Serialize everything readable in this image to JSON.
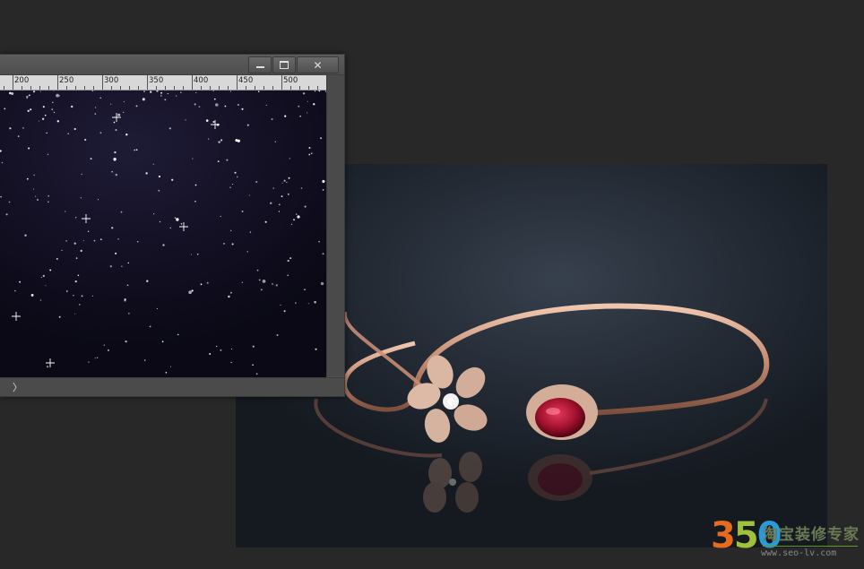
{
  "document_window": {
    "ruler_labels": [
      "200",
      "250",
      "300",
      "350",
      "400",
      "450",
      "500"
    ],
    "status_arrow": "〉",
    "buttons": {
      "minimize_icon": "minimize-icon",
      "maximize_icon": "maximize-icon",
      "close_icon": "close-icon",
      "close_glyph": "✕"
    }
  },
  "photo": {
    "subject": "bangle-bracelet",
    "colors": {
      "metal": "#c9967e",
      "ruby": "#a3122e",
      "background": "#232a34"
    }
  },
  "watermark": {
    "number": [
      "3",
      "5",
      "0"
    ],
    "brand_cn": "淘宝装修专家",
    "url": "www.seo-lv.com"
  }
}
